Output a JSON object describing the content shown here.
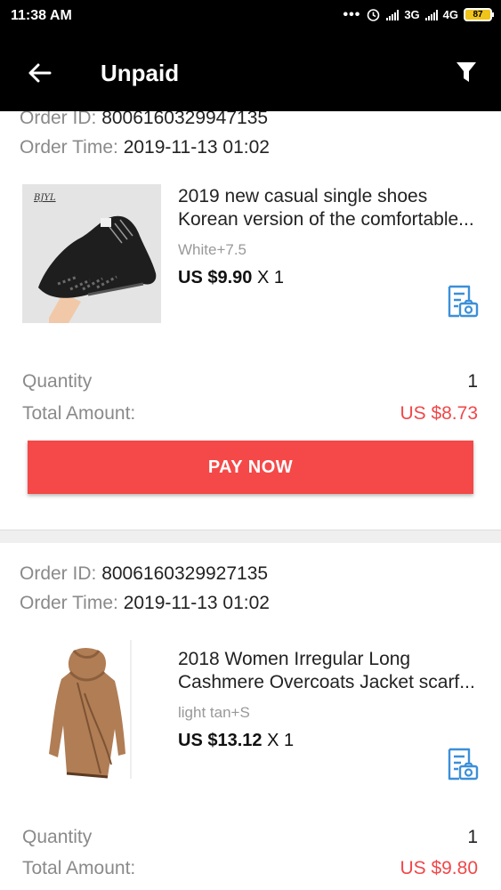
{
  "status_bar": {
    "time": "11:38 AM",
    "network_1": "3G",
    "network_2": "4G",
    "battery": "87"
  },
  "app_bar": {
    "title": "Unpaid"
  },
  "orders": [
    {
      "order_id_label": "Order ID:",
      "order_id": "8006160329947135",
      "order_time_label": "Order Time:",
      "order_time": "2019-11-13 01:02",
      "product": {
        "title_line1": "2019 new casual single shoes",
        "title_line2": "Korean version of the comfortable...",
        "variant": "White+7.5",
        "price": "US $9.90",
        "qty_text": "X 1",
        "image_brand": "BJYL"
      },
      "quantity_label": "Quantity",
      "quantity": "1",
      "total_label": "Total Amount:",
      "total": "US $8.73",
      "pay_button": "PAY NOW"
    },
    {
      "order_id_label": "Order ID:",
      "order_id": "8006160329927135",
      "order_time_label": "Order Time:",
      "order_time": "2019-11-13 01:02",
      "product": {
        "title_line1": "2018 Women Irregular Long",
        "title_line2": "Cashmere Overcoats Jacket scarf...",
        "variant": "light tan+S",
        "price": "US $13.12",
        "qty_text": "X 1"
      },
      "quantity_label": "Quantity",
      "quantity": "1",
      "total_label": "Total Amount:",
      "total": "US $9.80"
    }
  ],
  "colors": {
    "accent_red": "#f44948",
    "icon_blue": "#3b8fd9"
  }
}
